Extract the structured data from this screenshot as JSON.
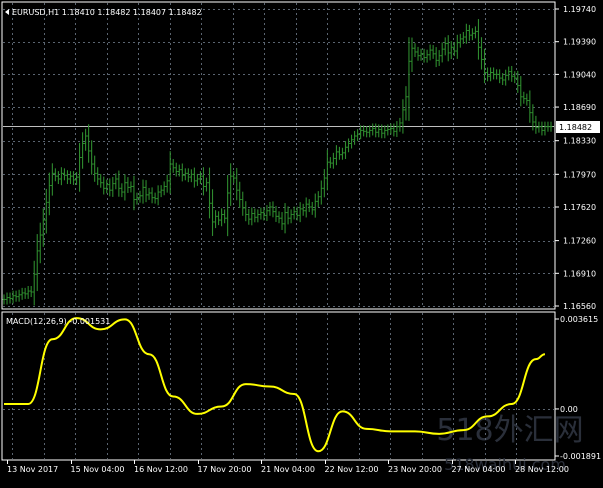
{
  "window": {
    "symbol_header": "EURUSD,H1  1.18410 1.18482 1.18407 1.18482",
    "current_price": "1.18482"
  },
  "colors": {
    "background": "#000000",
    "grid": "#5a6470",
    "price_bars": "#2e8b2e",
    "macd_line": "#ffff00",
    "text": "#ffffff",
    "current_price_tag_bg": "#ffffff",
    "current_price_tag_text": "#000000"
  },
  "price_axis": {
    "labels": [
      "1.19740",
      "1.19390",
      "1.19040",
      "1.18690",
      "1.18330",
      "1.17970",
      "1.17620",
      "1.17260",
      "1.16910",
      "1.16560"
    ]
  },
  "macd": {
    "label": "MACD(12,26,9) -0.001531",
    "axis_labels": [
      "0.003615",
      "0.00",
      "-0.001891"
    ]
  },
  "time_axis": {
    "labels": [
      "13 Nov 2017",
      "15 Nov 04:00",
      "16 Nov 12:00",
      "17 Nov 20:00",
      "21 Nov 04:00",
      "22 Nov 12:00",
      "23 Nov 20:00",
      "27 Nov 04:00",
      "28 Nov 12:00"
    ]
  },
  "watermark": {
    "line1": "518外汇网",
    "line2": "518waihui.com"
  },
  "chart_data": [
    {
      "type": "bar",
      "title": "EURUSD,H1",
      "ylim": [
        1.1656,
        1.1974
      ],
      "x": [
        0,
        1,
        2,
        3,
        4,
        5,
        6,
        7,
        8,
        9,
        10,
        11,
        12,
        13,
        14,
        15,
        16,
        17,
        18,
        19,
        20,
        21,
        22,
        23,
        24,
        25,
        26,
        27,
        28,
        29,
        30,
        31,
        32,
        33,
        34,
        35,
        36,
        37,
        38,
        39,
        40,
        41,
        42,
        43,
        44,
        45,
        46,
        47,
        48,
        49,
        50,
        51,
        52,
        53,
        54,
        55,
        56,
        57,
        58,
        59,
        60,
        61,
        62,
        63,
        64,
        65,
        66,
        67,
        68,
        69,
        70,
        71,
        72,
        73,
        74,
        75,
        76,
        77,
        78,
        79,
        80,
        81,
        82,
        83,
        84,
        85,
        86,
        87,
        88,
        89,
        90,
        91,
        92,
        93,
        94,
        95,
        96,
        97,
        98,
        99,
        100,
        101,
        102,
        103,
        104,
        105,
        106,
        107,
        108,
        109,
        110,
        111,
        112,
        113,
        114,
        115,
        116,
        117,
        118,
        119,
        120,
        121,
        122,
        123,
        124,
        125,
        126,
        127,
        128,
        129,
        130,
        131,
        132,
        133,
        134,
        135,
        136,
        137,
        138,
        139,
        140,
        141,
        142,
        143,
        144,
        145,
        146,
        147,
        148,
        149,
        150,
        151,
        152,
        153,
        154,
        155,
        156,
        157,
        158,
        159,
        160,
        161,
        162,
        163,
        164,
        165,
        166,
        167,
        168,
        169,
        170,
        171,
        172,
        173,
        174,
        175,
        176,
        177,
        178,
        179
      ],
      "close": [
        1.1663,
        1.1665,
        1.1664,
        1.1667,
        1.1666,
        1.1668,
        1.167,
        1.1669,
        1.1672,
        1.1671,
        1.169,
        1.1715,
        1.1732,
        1.1748,
        1.1767,
        1.1785,
        1.1798,
        1.1795,
        1.1792,
        1.1798,
        1.1796,
        1.1792,
        1.1795,
        1.1791,
        1.1794,
        1.1815,
        1.183,
        1.1838,
        1.1822,
        1.1808,
        1.1798,
        1.1792,
        1.1788,
        1.1782,
        1.1786,
        1.178,
        1.1787,
        1.1792,
        1.1782,
        1.1778,
        1.1788,
        1.1783,
        1.1784,
        1.177,
        1.1772,
        1.1774,
        1.1783,
        1.1775,
        1.1777,
        1.1772,
        1.1771,
        1.1778,
        1.178,
        1.1784,
        1.179,
        1.1808,
        1.1804,
        1.18,
        1.1802,
        1.1796,
        1.1798,
        1.1794,
        1.1797,
        1.179,
        1.1792,
        1.1795,
        1.1784,
        1.1788,
        1.1766,
        1.1746,
        1.1752,
        1.1748,
        1.1754,
        1.175,
        1.1777,
        1.1795,
        1.1793,
        1.178,
        1.177,
        1.1761,
        1.1754,
        1.1749,
        1.1755,
        1.1751,
        1.1754,
        1.1756,
        1.1753,
        1.1758,
        1.1762,
        1.1757,
        1.1752,
        1.175,
        1.1744,
        1.1756,
        1.175,
        1.1754,
        1.1757,
        1.1753,
        1.176,
        1.1758,
        1.1765,
        1.1762,
        1.1759,
        1.1768,
        1.1773,
        1.1782,
        1.1793,
        1.181,
        1.1809,
        1.1814,
        1.1821,
        1.1818,
        1.182,
        1.1826,
        1.183,
        1.1834,
        1.1838,
        1.184,
        1.1844,
        1.1843,
        1.1842,
        1.1844,
        1.1846,
        1.1842,
        1.1845,
        1.1841,
        1.1844,
        1.1845,
        1.1846,
        1.1843,
        1.1848,
        1.1852,
        1.1866,
        1.188,
        1.1918,
        1.1932,
        1.1928,
        1.1924,
        1.1926,
        1.1922,
        1.1925,
        1.193,
        1.1926,
        1.1919,
        1.1924,
        1.1931,
        1.1937,
        1.1927,
        1.1933,
        1.1929,
        1.1938,
        1.1942,
        1.1944,
        1.1951,
        1.1946,
        1.1948,
        1.195,
        1.1933,
        1.192,
        1.1906,
        1.1902,
        1.1906,
        1.1904,
        1.1904,
        1.19,
        1.1898,
        1.1903,
        1.1907,
        1.1902,
        1.19,
        1.1892,
        1.188,
        1.1878,
        1.1876,
        1.1863,
        1.1853,
        1.1847,
        1.1848,
        1.1844,
        1.1848,
        1.1848,
        1.1848
      ]
    },
    {
      "type": "line",
      "title": "MACD(12,26,9) -0.001531",
      "ylim": [
        -0.001891,
        0.003615
      ],
      "x": [
        0,
        8,
        16,
        24,
        32,
        40,
        48,
        56,
        64,
        72,
        80,
        88,
        96,
        104,
        112,
        120,
        128,
        136,
        144,
        152,
        160,
        168,
        176,
        179
      ],
      "values": [
        0.0002,
        0.0002,
        0.0028,
        0.00365,
        0.0032,
        0.0036,
        0.0022,
        0.0005,
        -0.0002,
        0.0001,
        0.001,
        0.0009,
        0.0006,
        -0.0017,
        -0.0001,
        -0.0008,
        -0.0009,
        -0.0009,
        -0.001,
        -0.00085,
        -0.0003,
        0.0002,
        0.002,
        0.0022
      ]
    }
  ]
}
